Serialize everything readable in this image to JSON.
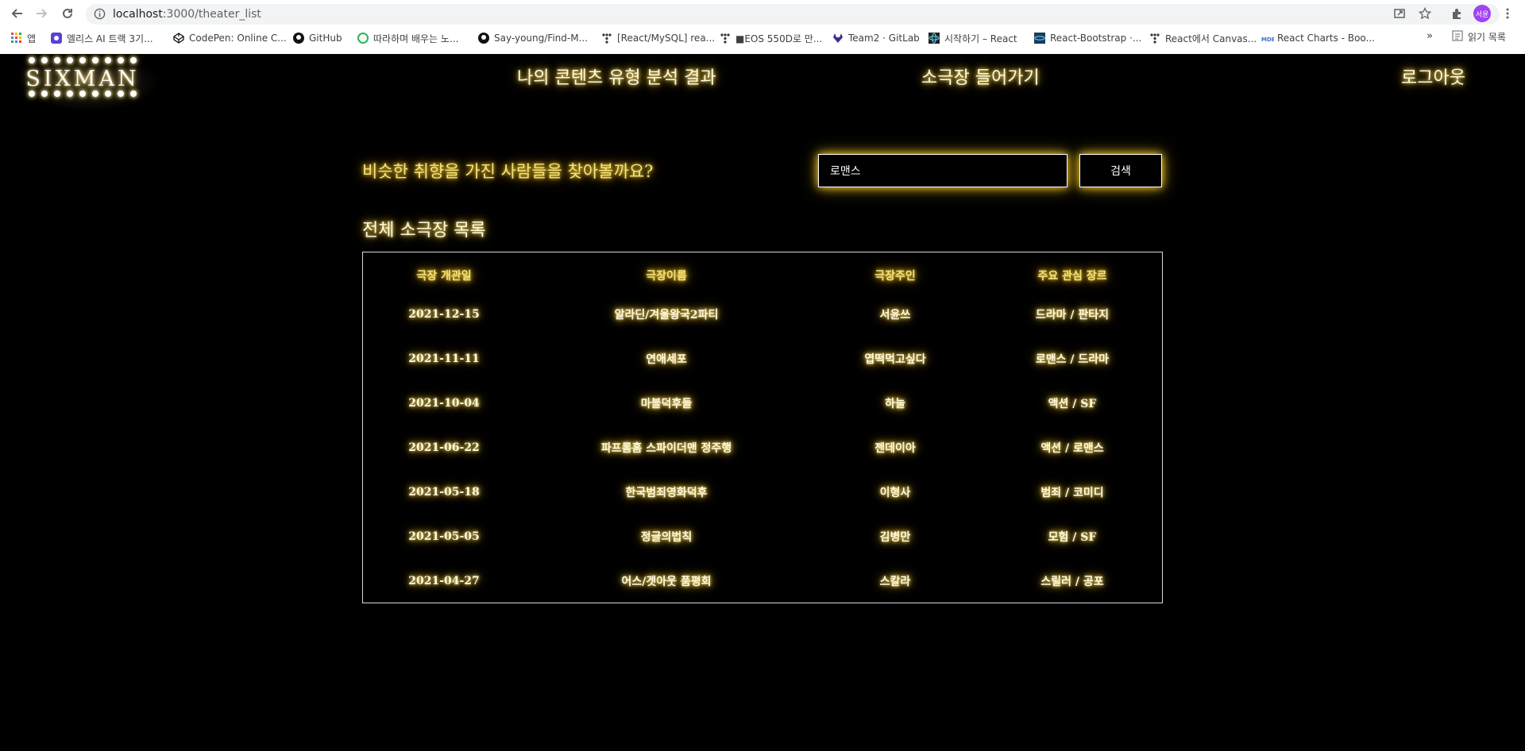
{
  "browser": {
    "url_host": "localhost",
    "url_path": ":3000/theater_list",
    "profile_label": "서윤",
    "bookmarks": [
      {
        "label": "앱",
        "icon": "apps-grid-icon",
        "color": "#ea4335"
      },
      {
        "label": "엘리스 AI 트랙 3기...",
        "icon": "elice-icon",
        "color": "#5a3fd8"
      },
      {
        "label": "CodePen: Online C...",
        "icon": "codepen-icon",
        "color": "#111111"
      },
      {
        "label": "GitHub",
        "icon": "github-icon",
        "color": "#111111"
      },
      {
        "label": "따라하며 배우는 노...",
        "icon": "green-logo-icon",
        "color": "#2fb35a"
      },
      {
        "label": "Say-young/Find-M...",
        "icon": "github-icon",
        "color": "#111111"
      },
      {
        "label": "[React/MySQL] rea...",
        "icon": "tistory-icon",
        "color": "#333333"
      },
      {
        "label": "■EOS 550D로 만...",
        "icon": "tistory-icon",
        "color": "#333333"
      },
      {
        "label": "Team2 · GitLab",
        "icon": "gitlab-icon",
        "color": "#3a2f8f"
      },
      {
        "label": "시작하기 – React",
        "icon": "react-icon",
        "color": "#222222"
      },
      {
        "label": "React-Bootstrap ·...",
        "icon": "react-bootstrap-icon",
        "color": "#1b3a5e"
      },
      {
        "label": "React에서 Canvas...",
        "icon": "tistory-icon",
        "color": "#333333"
      },
      {
        "label": "React Charts - Boo...",
        "icon": "mdb-icon",
        "color": "#3b71ca"
      }
    ],
    "more_label": "»",
    "reading_list_label": "읽기 목록"
  },
  "header": {
    "logo_text": "SIXMAN",
    "nav": {
      "analysis": "나의 콘텐츠 유형 분석 결과",
      "enter_theater": "소극장 들어가기",
      "logout": "로그아웃"
    }
  },
  "search": {
    "question": "비슷한 취향을 가진 사람들을 찾아볼까요?",
    "input_value": "로맨스",
    "button_label": "검색"
  },
  "list": {
    "title": "전체 소극장 목록",
    "columns": [
      "극장 개관일",
      "극장이름",
      "극장주인",
      "주요 관심 장르"
    ],
    "rows": [
      [
        "2021-12-15",
        "알라딘/겨울왕국2파티",
        "서윤쓰",
        "드라마 / 판타지"
      ],
      [
        "2021-11-11",
        "연애세포",
        "엽떡먹고싶다",
        "로맨스 / 드라마"
      ],
      [
        "2021-10-04",
        "마블덕후들",
        "하늘",
        "액션 / SF"
      ],
      [
        "2021-06-22",
        "파프롬홈 스파이더맨 정주행",
        "젠데이아",
        "액션 / 로맨스"
      ],
      [
        "2021-05-18",
        "한국범죄영화덕후",
        "이형사",
        "범죄 / 코미디"
      ],
      [
        "2021-05-05",
        "정글의법칙",
        "김병만",
        "모험 / SF"
      ],
      [
        "2021-04-27",
        "어스/겟아웃 품평회",
        "스칼라",
        "스릴러 / 공포"
      ]
    ]
  },
  "colors": {
    "background": "#000000",
    "glow_gold": "#f5e27a",
    "glow_white": "#fff8dc"
  }
}
